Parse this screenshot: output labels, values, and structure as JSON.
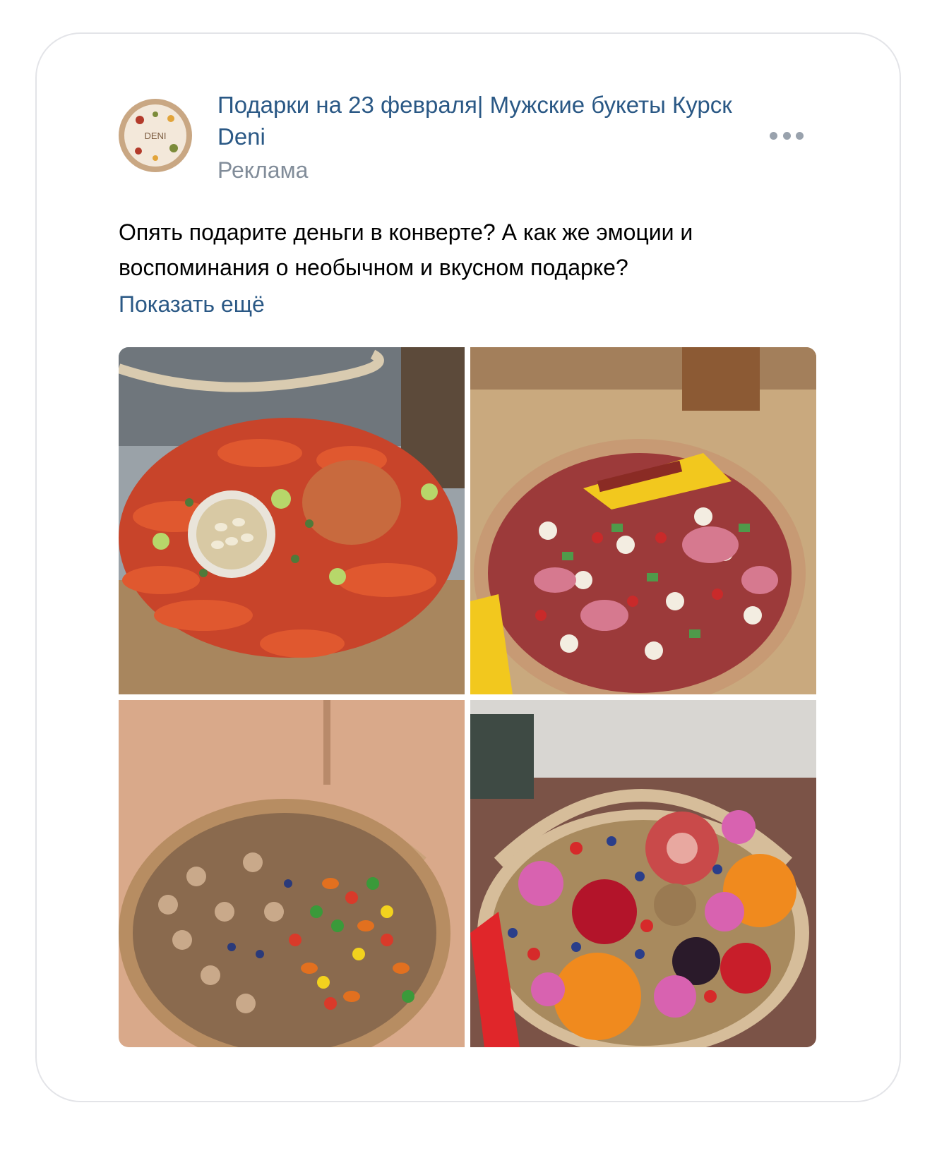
{
  "post": {
    "group_name": "Подарки на 23 февраля| Мужские букеты Курск Deni",
    "ad_label": "Реклама",
    "text": "Опять подарите деньги в конверте? А как же эмоции и воспоминания о необычном и вкусном подарке?",
    "show_more": "Показать ещё",
    "avatar_text": "DENI"
  },
  "icons": {
    "more": "more-horizontal-icon"
  },
  "colors": {
    "link": "#2a5885",
    "secondary": "#818c99",
    "text": "#000000"
  },
  "photos": [
    {
      "subject": "crayfish-platter"
    },
    {
      "subject": "meat-bouquet-basket"
    },
    {
      "subject": "nuts-candied-fruit-basket"
    },
    {
      "subject": "fruit-flower-basket"
    }
  ]
}
